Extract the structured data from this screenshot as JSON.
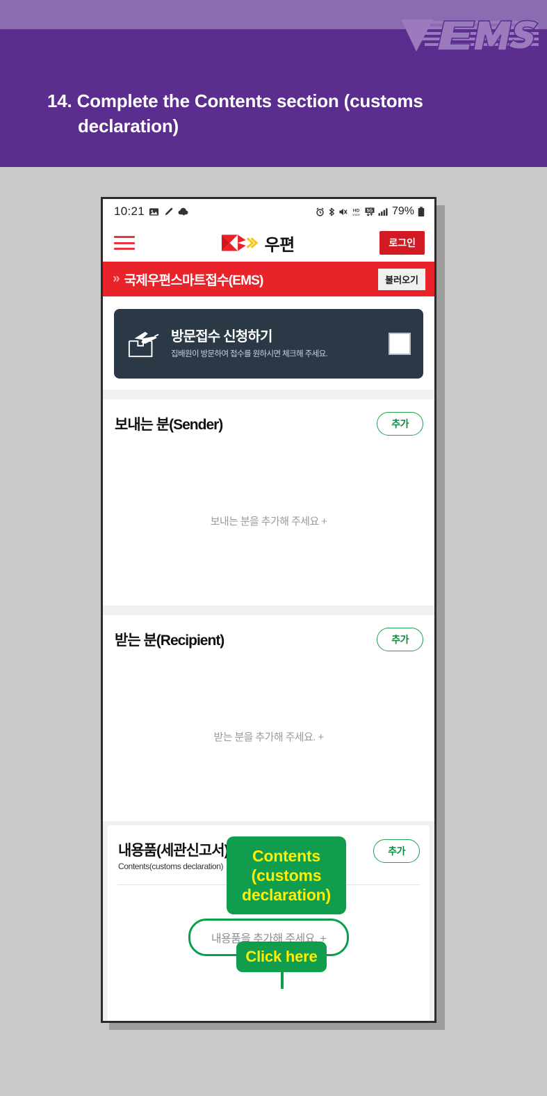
{
  "banner": {
    "title_line1": "14. Complete the Contents section (customs",
    "title_line2": "declaration)",
    "logo_text": "EMS",
    "color_light": "#8a6cb0",
    "color_dark": "#5b2d8e"
  },
  "phone": {
    "statusbar": {
      "time": "10:21",
      "left_icons": [
        "photo-icon",
        "pen-icon",
        "cloud-icon"
      ],
      "right_icons": [
        "alarm-icon",
        "bluetooth-icon",
        "mute-icon",
        "hd-voice-icon",
        "5g-icon",
        "signal-bars-icon"
      ],
      "battery_percent": "79%"
    },
    "appbar": {
      "menu_icon": "hamburger-icon",
      "brand_text": "우편",
      "login_label": "로그인"
    },
    "redbar": {
      "chevron": "»",
      "title": "국제우편스마트접수(EMS)",
      "button_label": "불러오기",
      "color": "#e8232a"
    },
    "visit_card": {
      "title": "방문접수 신청하기",
      "subtitle": "집배원이 방문하여 접수를 원하시면 체크해 주세요.",
      "icon": "airplane-box-icon",
      "checkbox_checked": false,
      "color": "#2b3846"
    },
    "sections": [
      {
        "key": "sender",
        "title": "보내는 분(Sender)",
        "add_label": "추가",
        "empty_text": "보내는 분을 추가해 주세요 +"
      },
      {
        "key": "recipient",
        "title": "받는 분(Recipient)",
        "add_label": "추가",
        "empty_text": "받는 분을 추가해 주세요. +"
      }
    ],
    "contents_section": {
      "title": "내용품(세관신고서)",
      "subtitle": "Contents(customs declaration)",
      "add_label": "추가",
      "empty_text": "내용품을 추가해 주세요. +"
    }
  },
  "annotations": {
    "contents_label": "Contents (customs declaration)",
    "contents_label_l1": "Contents",
    "contents_label_l2": "(customs",
    "contents_label_l3": "declaration)",
    "click_here": "Click here",
    "bg_color": "#119d4e",
    "text_color": "#ffee00"
  }
}
